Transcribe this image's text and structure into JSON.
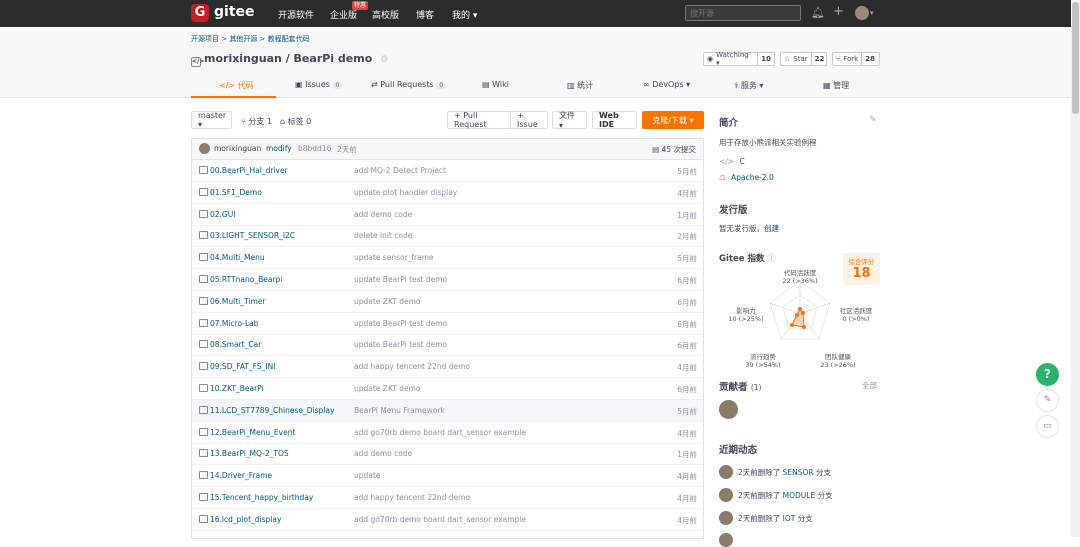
{
  "nav": {
    "logo_letter": "G",
    "logo_text": "gitee",
    "items": [
      "开源软件",
      "企业版",
      "高校版",
      "博客",
      "我的 ▾"
    ],
    "enterprise_badge": "特惠",
    "search_placeholder": "搜开源"
  },
  "breadcrumb": "开源项目 > 其他开源 > 教程配套代码",
  "repo": {
    "owner": "morixinguan",
    "name": "BearPi demo",
    "title": "morixinguan / BearPi demo",
    "watching_label": "Watching ▾",
    "watching_count": "10",
    "star_label": "Star",
    "star_count": "22",
    "fork_label": "Fork",
    "fork_count": "28"
  },
  "tabs": [
    {
      "label": "代码",
      "count": ""
    },
    {
      "label": "Issues",
      "count": "0"
    },
    {
      "label": "Pull Requests",
      "count": "0"
    },
    {
      "label": "Wiki",
      "count": ""
    },
    {
      "label": "统计",
      "count": ""
    },
    {
      "label": "DevOps ▾",
      "count": ""
    },
    {
      "label": "服务 ▾",
      "count": ""
    },
    {
      "label": "管理",
      "count": ""
    }
  ],
  "toolbar": {
    "branch": "master ▾",
    "branches": "分支 1",
    "tags": "标签 0",
    "pull_request": "+ Pull Request",
    "issue": "+ Issue",
    "files": "文件 ▾",
    "web_ide": "Web IDE",
    "clone": "克隆/下载 ▾"
  },
  "commit": {
    "author": "morixinguan",
    "message": "modify",
    "hash": "b8bdd16",
    "time": "2天前",
    "count_label": "45 次提交"
  },
  "files": [
    {
      "name": "00.BearPi_Hal_driver",
      "msg": "add MQ-2 Detect Project",
      "time": "5月前"
    },
    {
      "name": "01.SF1_Demo",
      "msg": "update plot handler display",
      "time": "4月前"
    },
    {
      "name": "02.GUI",
      "msg": "add demo code",
      "time": "1月前"
    },
    {
      "name": "03.LIGHT_SENSOR_I2C",
      "msg": "delete init code",
      "time": "2月前"
    },
    {
      "name": "04.Multi_Menu",
      "msg": "update sensor_frame",
      "time": "5月前"
    },
    {
      "name": "05.RTTnano_Bearpi",
      "msg": "update BearPi test demo",
      "time": "6月前"
    },
    {
      "name": "06.Multi_Timer",
      "msg": "update ZKT demo",
      "time": "6月前"
    },
    {
      "name": "07.Micro-Lab",
      "msg": "update BearPi test demo",
      "time": "6月前"
    },
    {
      "name": "08.Smart_Car",
      "msg": "update BearPi test demo",
      "time": "6月前"
    },
    {
      "name": "09.SD_FAT_FS_INI",
      "msg": "add happy tencent 22nd demo",
      "time": "4月前"
    },
    {
      "name": "10.ZKT_BearPi",
      "msg": "update ZKT demo",
      "time": "6月前"
    },
    {
      "name": "11.LCD_ST7789_Chinese_Display",
      "msg": "BearPi Menu Framework",
      "time": "5月前"
    },
    {
      "name": "12.BearPi_Menu_Event",
      "msg": "add go70rb demo board dart_sensor example",
      "time": "4月前"
    },
    {
      "name": "13.BearPi_MQ-2_TOS",
      "msg": "add demo code",
      "time": "1月前"
    },
    {
      "name": "14.Driver_Frame",
      "msg": "update",
      "time": "4月前"
    },
    {
      "name": "15.Tencent_happy_birthday",
      "msg": "add happy tencent 22nd demo",
      "time": "4月前"
    },
    {
      "name": "16.lcd_plot_display",
      "msg": "add go70rb demo board dart_sensor example",
      "time": "4月前"
    }
  ],
  "sidebar": {
    "intro_title": "简介",
    "intro_text": "用于存放小熊派相关实验例程",
    "language": "C",
    "license": "Apache-2.0",
    "release_title": "发行版",
    "release_text": "暂无发行版，",
    "release_create": "创建",
    "index_title": "Gitee 指数",
    "score_label": "综合评分",
    "score_value": "18",
    "radar": {
      "code_activity": "代码活跃度",
      "code_activity_val": "22 (>36%)",
      "influence": "影响力",
      "influence_val": "10 (>25%)",
      "community": "社区活跃度",
      "community_val": "0 (>0%)",
      "trend": "流行趋势",
      "trend_val": "39 (>54%)",
      "team": "团队健康",
      "team_val": "23 (>26%)"
    },
    "contrib_title": "贡献者",
    "contrib_count": "(1)",
    "contrib_all": "全部",
    "activity_title": "近期动态",
    "activities": [
      {
        "prefix": "2天前删除了 ",
        "target": "SENSOR",
        "suffix": " 分支"
      },
      {
        "prefix": "2天前删除了 ",
        "target": "MODULE",
        "suffix": " 分支"
      },
      {
        "prefix": "2天前删除了 ",
        "target": "IOT",
        "suffix": " 分支"
      }
    ]
  },
  "colors": {
    "accent": "#fe7300",
    "link": "#005980",
    "nav_bg": "#2c2c2c",
    "help_green": "#29b36c"
  }
}
